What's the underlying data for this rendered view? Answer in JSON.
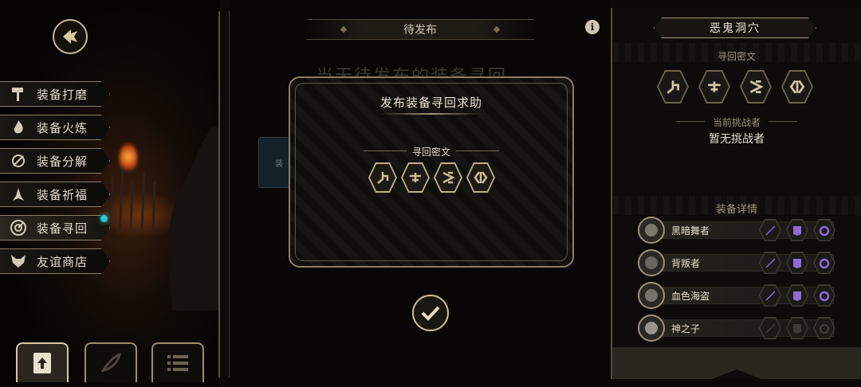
{
  "left_menu": {
    "items": [
      {
        "label": "装备打磨",
        "icon": "hammer-icon"
      },
      {
        "label": "装备火炼",
        "icon": "flame-icon"
      },
      {
        "label": "装备分解",
        "icon": "decompose-icon"
      },
      {
        "label": "装备祈福",
        "icon": "pray-hands-icon"
      },
      {
        "label": "装备寻回",
        "icon": "target-icon",
        "active": true
      },
      {
        "label": "友谊商店",
        "icon": "fox-icon"
      }
    ],
    "bottom_tabs": [
      "upload-icon",
      "feather-icon",
      "list-icon"
    ]
  },
  "center": {
    "header": "待发布",
    "background_text": "当无待发布的装备寻回",
    "card_glyph": "装"
  },
  "dialog": {
    "title": "发布装备寻回求助",
    "rune_label": "寻回密文"
  },
  "right_panel": {
    "boss_title": "恶鬼洞穴",
    "cipher_label": "寻回密文",
    "challenger_label": "当前挑战者",
    "challenger_value": "暂无挑战者",
    "details_label": "装备详情",
    "heroes": [
      {
        "name": "黑暗舞者",
        "slots_active": true
      },
      {
        "name": "背叛者",
        "slots_active": true
      },
      {
        "name": "血色海盗",
        "slots_active": true
      },
      {
        "name": "神之子",
        "slots_active": false
      }
    ]
  },
  "colors": {
    "gold": "#c9b891",
    "purple_slot": "#8d6ad6",
    "notification": "#27c7c9"
  }
}
